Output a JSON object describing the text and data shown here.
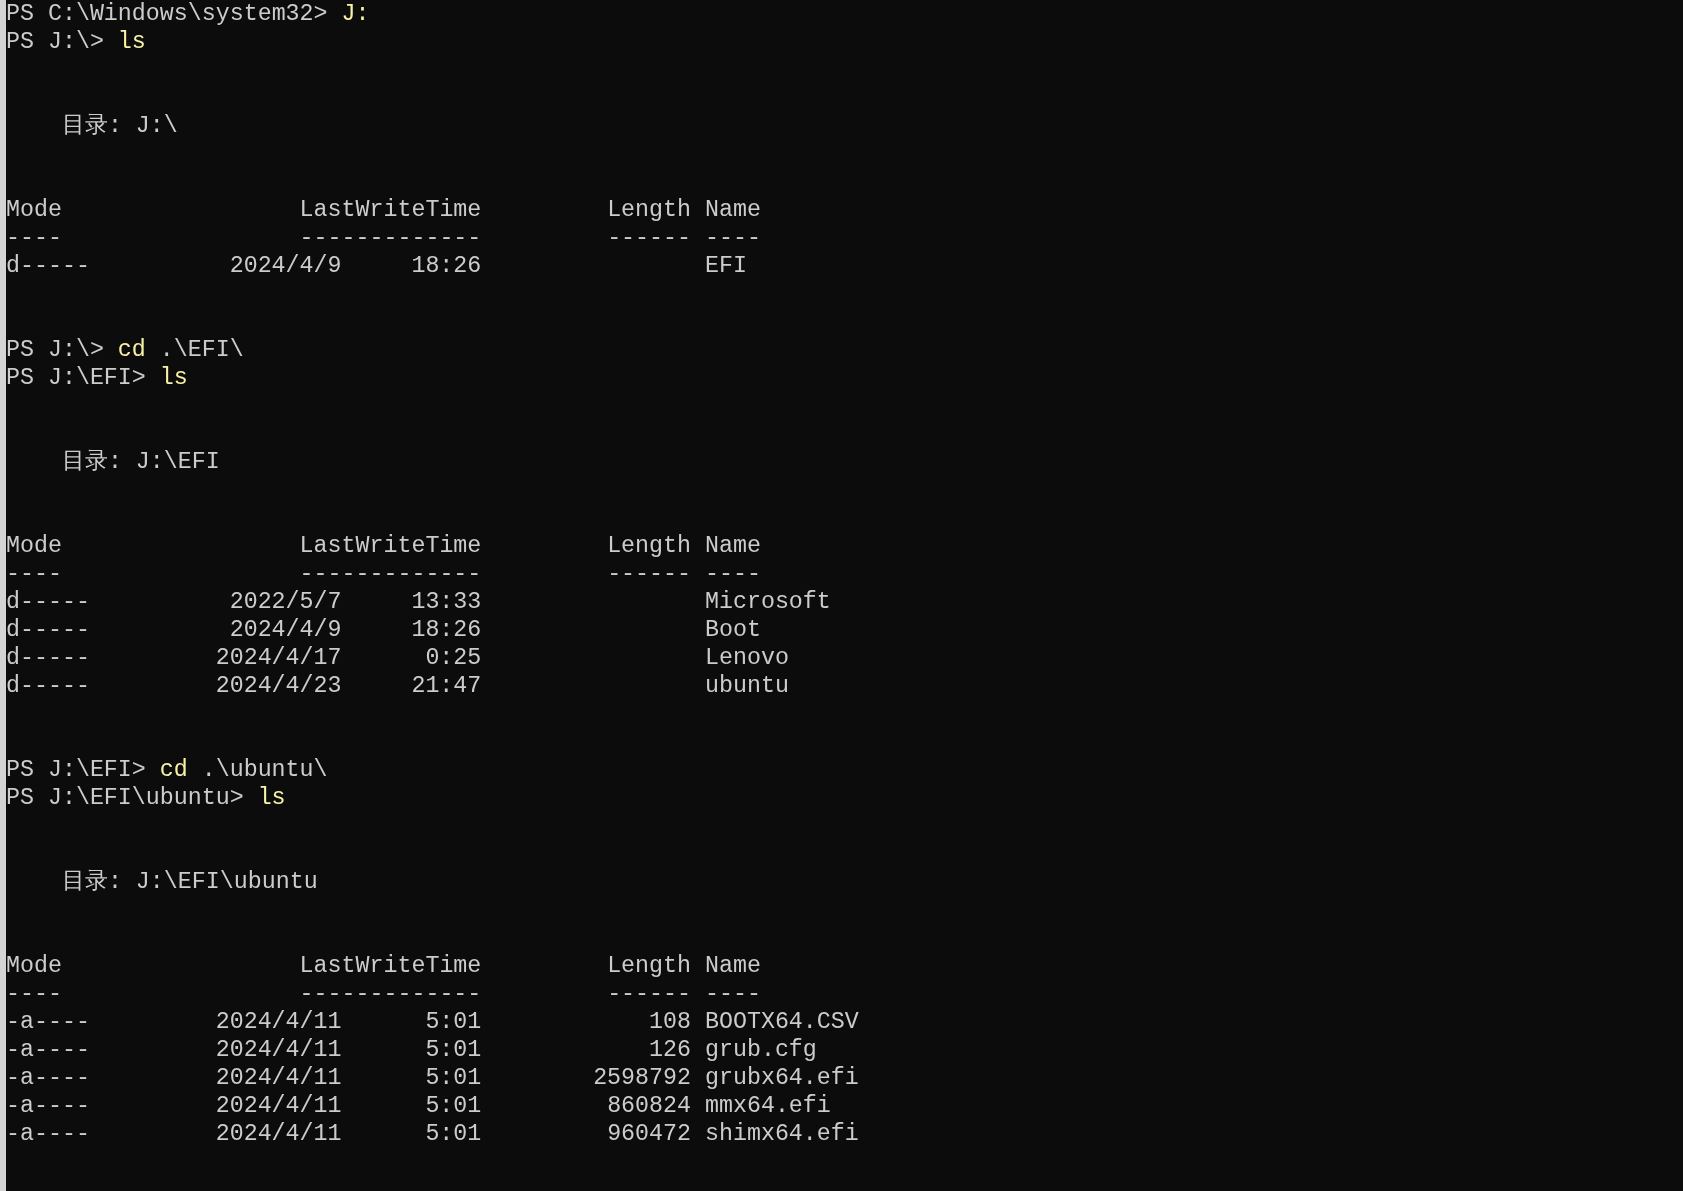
{
  "commands": [
    {
      "prompt": "PS C:\\Windows\\system32>",
      "command": "J:"
    },
    {
      "prompt": "PS J:\\>",
      "command": "ls",
      "listing": {
        "heading": "目录: J:\\",
        "columns": [
          "Mode",
          "LastWriteTime",
          "Length",
          "Name"
        ],
        "underlines": [
          "----",
          "-------------",
          "------",
          "----"
        ],
        "rows": [
          {
            "mode": "d-----",
            "date": "2024/4/9",
            "time": "18:26",
            "name": "EFI"
          }
        ]
      }
    },
    {
      "prompt": "PS J:\\>",
      "command": "cd",
      "argument": ".\\EFI\\"
    },
    {
      "prompt": "PS J:\\EFI>",
      "command": "ls",
      "listing": {
        "heading": "目录: J:\\EFI",
        "columns": [
          "Mode",
          "LastWriteTime",
          "Length",
          "Name"
        ],
        "underlines": [
          "----",
          "-------------",
          "------",
          "----"
        ],
        "rows": [
          {
            "mode": "d-----",
            "date": "2022/5/7",
            "time": "13:33",
            "name": "Microsoft"
          },
          {
            "mode": "d-----",
            "date": "2024/4/9",
            "time": "18:26",
            "name": "Boot"
          },
          {
            "mode": "d-----",
            "date": "2024/4/17",
            "time": "0:25",
            "name": "Lenovo"
          },
          {
            "mode": "d-----",
            "date": "2024/4/23",
            "time": "21:47",
            "name": "ubuntu"
          }
        ]
      }
    },
    {
      "prompt": "PS J:\\EFI>",
      "command": "cd",
      "argument": ".\\ubuntu\\"
    },
    {
      "prompt": "PS J:\\EFI\\ubuntu>",
      "command": "ls",
      "listing": {
        "heading": "目录: J:\\EFI\\ubuntu",
        "columns": [
          "Mode",
          "LastWriteTime",
          "Length",
          "Name"
        ],
        "underlines": [
          "----",
          "-------------",
          "------",
          "----"
        ],
        "rows": [
          {
            "mode": "-a----",
            "date": "2024/4/11",
            "time": "5:01",
            "length": "108",
            "name": "BOOTX64.CSV"
          },
          {
            "mode": "-a----",
            "date": "2024/4/11",
            "time": "5:01",
            "length": "126",
            "name": "grub.cfg"
          },
          {
            "mode": "-a----",
            "date": "2024/4/11",
            "time": "5:01",
            "length": "2598792",
            "name": "grubx64.efi"
          },
          {
            "mode": "-a----",
            "date": "2024/4/11",
            "time": "5:01",
            "length": "860824",
            "name": "mmx64.efi"
          },
          {
            "mode": "-a----",
            "date": "2024/4/11",
            "time": "5:01",
            "length": "960472",
            "name": "shimx64.efi"
          }
        ]
      }
    }
  ]
}
